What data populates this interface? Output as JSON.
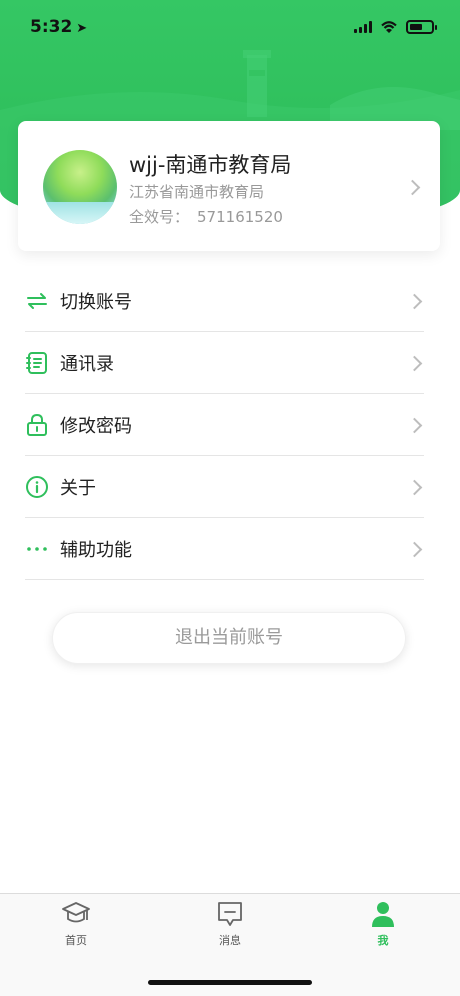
{
  "status_bar": {
    "time": "5:32"
  },
  "profile": {
    "name": "wjj-南通市教育局",
    "organization": "江苏省南通市教育局",
    "id_label": "全效号：",
    "id_number": "571161520"
  },
  "menu": [
    {
      "label": "切换账号",
      "icon": "switch-account-icon"
    },
    {
      "label": "通讯录",
      "icon": "contacts-icon"
    },
    {
      "label": "修改密码",
      "icon": "lock-icon"
    },
    {
      "label": "关于",
      "icon": "info-icon"
    },
    {
      "label": "辅助功能",
      "icon": "more-icon"
    }
  ],
  "logout_label": "退出当前账号",
  "tabbar": {
    "tabs": [
      {
        "label": "首页",
        "icon": "graduation-cap-icon",
        "active": false
      },
      {
        "label": "消息",
        "icon": "message-icon",
        "active": false
      },
      {
        "label": "我",
        "icon": "person-icon",
        "active": true
      }
    ]
  },
  "colors": {
    "accent": "#2fbf5c",
    "text": "#222222",
    "muted": "#999999"
  }
}
